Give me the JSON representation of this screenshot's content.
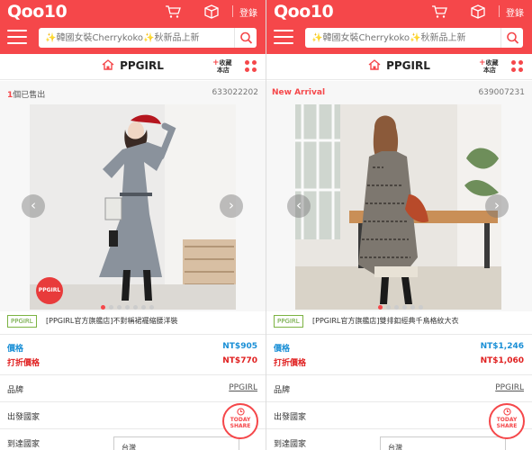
{
  "header": {
    "logo": "Qoo10",
    "login": "登錄",
    "search_placeholder": "✨韓國女裝Cherrykoko✨秋新品上新"
  },
  "shop": {
    "name": "PPGIRL",
    "favorite_line1": "收藏",
    "favorite_line2": "本店"
  },
  "products": [
    {
      "sold_count": "1",
      "sold_text": "個已售出",
      "product_id": "633022202",
      "brand_badge": "PPGIRL",
      "shop_tag": "PPGIRL",
      "title": "[PPGIRL官方旗艦店]不對稱裙襬縮腰洋裝",
      "price_label": "價格",
      "price": "NT$905",
      "discount_label": "打折價格",
      "discount_price": "NT$770",
      "brand_label": "品牌",
      "brand_value": "PPGIRL",
      "origin_label": "出發國家",
      "dest_label": "到達國家",
      "dest_value": "台灣"
    },
    {
      "tagline": "New Arrival",
      "product_id": "639007231",
      "shop_tag": "PPGIRL",
      "title": "[PPGIRL官方旗艦店]雙排釦經典千鳥格紋大衣",
      "price_label": "價格",
      "price": "NT$1,246",
      "discount_label": "打折價格",
      "discount_price": "NT$1,060",
      "brand_label": "品牌",
      "brand_value": "PPGIRL",
      "origin_label": "出發國家",
      "dest_label": "到達國家",
      "dest_value": "台灣"
    }
  ],
  "today_share": {
    "line1": "TODAY",
    "line2": "SHARE"
  },
  "colors": {
    "brand_red": "#f5474a",
    "price_blue": "#1a8fd6",
    "discount_red": "#e02020",
    "shop_tag_green": "#7cb342"
  },
  "icons": [
    "cart-icon",
    "package-icon",
    "menu-icon",
    "search-icon",
    "home-icon",
    "grid-icon",
    "chevron-left-icon",
    "chevron-right-icon",
    "clock-icon"
  ]
}
